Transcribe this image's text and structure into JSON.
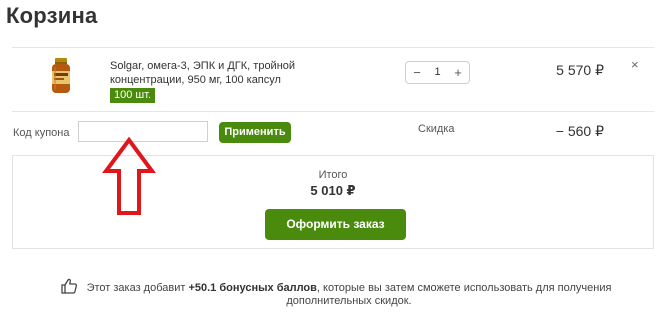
{
  "page": {
    "title": "Корзина"
  },
  "cart_item": {
    "name": "Solgar, омега-3, ЭПК и ДГК, тройной концентрации, 950 мг, 100 капсул",
    "variant_badge": "100 шт.",
    "quantity": "1",
    "minus_symbol": "−",
    "plus_symbol": "+",
    "price": "5 570 ₽",
    "remove_symbol": "×"
  },
  "coupon": {
    "label": "Код купона",
    "input_value": "",
    "apply_label": "Применить"
  },
  "discount": {
    "label": "Скидка",
    "value": "− 560 ₽"
  },
  "summary": {
    "total_label": "Итого",
    "total_value": "5 010 ₽",
    "checkout_label": "Оформить заказ"
  },
  "bonus": {
    "prefix": "Этот заказ добавит ",
    "highlight": "+50.1 бонусных баллов",
    "suffix": ", которые вы затем сможете использовать для получения дополнительных скидок."
  },
  "colors": {
    "accent_green": "#4a8a0c",
    "annotation_red": "#e0161d"
  },
  "icons": [
    "supplement-bottle-icon",
    "thumbs-up-icon",
    "up-arrow-annotation-icon"
  ]
}
